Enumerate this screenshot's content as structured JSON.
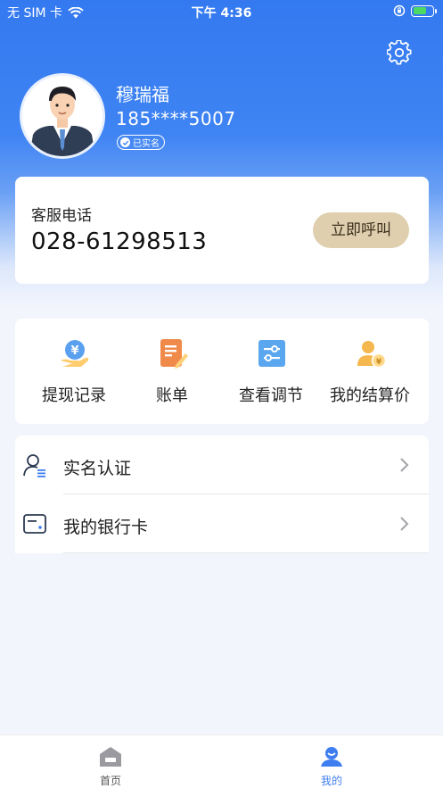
{
  "status_bar": {
    "carrier": "无 SIM 卡",
    "time": "下午 4:36"
  },
  "profile": {
    "name": "穆瑞福",
    "phone": "185****5007",
    "verified_label": "已实名"
  },
  "customer_service": {
    "label": "客服电话",
    "number": "028-61298513",
    "call_button": "立即呼叫"
  },
  "quick_actions": [
    {
      "label": "提现记录",
      "icon": "withdraw-record-icon"
    },
    {
      "label": "账单",
      "icon": "bill-icon"
    },
    {
      "label": "查看调节",
      "icon": "adjust-icon"
    },
    {
      "label": "我的结算价",
      "icon": "settlement-price-icon"
    }
  ],
  "menu_list": [
    {
      "label": "实名认证",
      "icon": "user-id-icon"
    },
    {
      "label": "我的银行卡",
      "icon": "bank-card-icon"
    }
  ],
  "tab_bar": {
    "tabs": [
      {
        "label": "首页",
        "icon": "home-icon",
        "active": false
      },
      {
        "label": "我的",
        "icon": "profile-icon",
        "active": true
      }
    ]
  },
  "colors": {
    "primary_blue": "#3479f0",
    "call_button_bg": "#dfcfaf",
    "tab_active": "#3f7ef0",
    "tab_inactive": "#555555"
  }
}
